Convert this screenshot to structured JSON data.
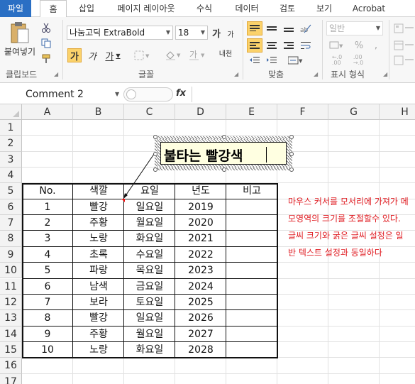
{
  "tabs": [
    "파일",
    "홈",
    "삽입",
    "페이지 레이아웃",
    "수식",
    "데이터",
    "검토",
    "보기",
    "Acrobat"
  ],
  "ribbon": {
    "paste_label": "붙여넣기",
    "clipboard_label": "클립보드",
    "font_name": "나눔고딕 ExtraBold",
    "font_size": "18",
    "grow_font": "가",
    "shrink_font": "가",
    "bold": "가",
    "italic": "가",
    "underline": "가",
    "font_label": "글꼴",
    "phonetic": "내천",
    "align_label": "맞춤",
    "number_format": "일반",
    "percent": "%",
    "comma": ",",
    "number_label": "표시 형식"
  },
  "formula_bar": {
    "name_box": "Comment 2",
    "fx": "fx",
    "formula": ""
  },
  "columns": [
    "A",
    "B",
    "C",
    "D",
    "E",
    "F",
    "G",
    "H"
  ],
  "rows": [
    "1",
    "2",
    "3",
    "4",
    "5",
    "6",
    "7",
    "8",
    "9",
    "10",
    "11",
    "12",
    "13",
    "14",
    "15",
    "16",
    "17"
  ],
  "table": {
    "headers": [
      "No.",
      "색깔",
      "요일",
      "년도",
      "비고"
    ],
    "rows": [
      [
        "1",
        "빨강",
        "일요일",
        "2019",
        ""
      ],
      [
        "2",
        "주황",
        "월요일",
        "2020",
        ""
      ],
      [
        "3",
        "노랑",
        "화요일",
        "2021",
        ""
      ],
      [
        "4",
        "초록",
        "수요일",
        "2022",
        ""
      ],
      [
        "5",
        "파랑",
        "목요일",
        "2023",
        ""
      ],
      [
        "6",
        "남색",
        "금요일",
        "2024",
        ""
      ],
      [
        "7",
        "보라",
        "토요일",
        "2025",
        ""
      ],
      [
        "8",
        "빨강",
        "일요일",
        "2026",
        ""
      ],
      [
        "9",
        "주황",
        "월요일",
        "2027",
        ""
      ],
      [
        "10",
        "노랑",
        "화요일",
        "2028",
        ""
      ]
    ]
  },
  "comment": {
    "text": "불타는 빨강색"
  },
  "note": {
    "text": "마우스 커서를 모서리에 가져가 메모영역의 크기를 조절할수 있다. 글씨 크기와 굵은 글씨 설정은 일반 텍스트 설정과 동일하다"
  },
  "colors": {
    "file_tab": "#2a6fc4",
    "note_text": "#e01e24",
    "comment_bg": "#ffffe1",
    "highlight": "#fbd26b",
    "indicator": "#e11"
  }
}
